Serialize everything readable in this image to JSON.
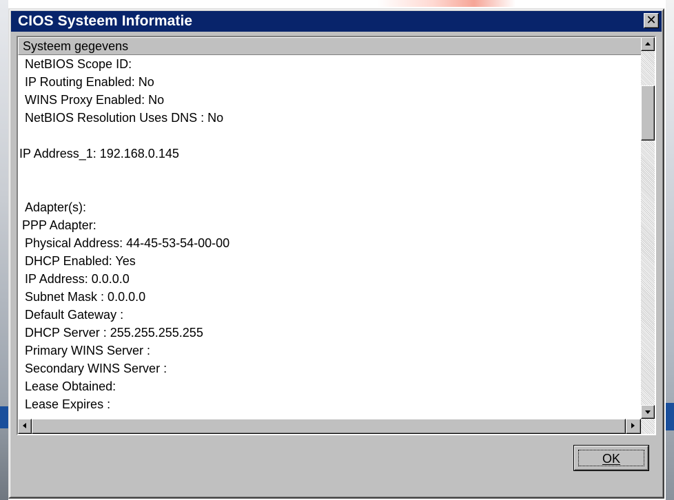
{
  "window": {
    "title": "CIOS Systeem Informatie",
    "close_glyph": "✕",
    "close_icon": "close-icon"
  },
  "listbox": {
    "header": "Systeem gegevens",
    "lines": [
      "NetBIOS Scope ID:",
      "IP Routing Enabled: No",
      "WINS Proxy Enabled: No",
      "NetBIOS Resolution Uses DNS : No",
      "",
      "IP Address_1: 192.168.0.145",
      "",
      "",
      "Adapter(s):",
      "PPP Adapter:",
      "Physical Address: 44-45-53-54-00-00",
      "DHCP Enabled: Yes",
      "IP Address: 0.0.0.0",
      "Subnet Mask : 0.0.0.0",
      "Default Gateway :",
      "DHCP Server : 255.255.255.255",
      "Primary WINS Server :",
      "Secondary WINS Server :",
      "Lease Obtained:",
      "Lease Expires :"
    ]
  },
  "buttons": {
    "ok_label": "OK"
  },
  "scrollbars": {
    "up_icon": "scroll-up-arrow-icon",
    "down_icon": "scroll-down-arrow-icon",
    "left_icon": "scroll-left-arrow-icon",
    "right_icon": "scroll-right-arrow-icon"
  },
  "colors": {
    "titlebar": "#08246b",
    "face": "#c0c0c0",
    "list_bg": "#ffffff"
  }
}
